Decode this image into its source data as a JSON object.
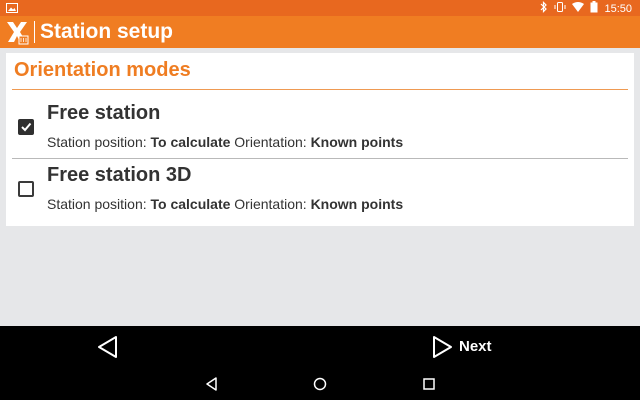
{
  "status_bar": {
    "time": "15:50",
    "icons": [
      "gallery-icon",
      "bluetooth-icon",
      "vibrate-icon",
      "wifi-icon",
      "battery-icon"
    ]
  },
  "app_bar": {
    "title": "Station setup",
    "logo": "xpad-logo-icon"
  },
  "section": {
    "title": "Orientation modes"
  },
  "options": [
    {
      "title": "Free station",
      "checked": true,
      "position_label": "Station position:",
      "position_value": "To calculate",
      "orientation_label": "Orientation:",
      "orientation_value": "Known points"
    },
    {
      "title": "Free station 3D",
      "checked": false,
      "position_label": "Station position:",
      "position_value": "To calculate",
      "orientation_label": "Orientation:",
      "orientation_value": "Known points"
    }
  ],
  "bottom_bar": {
    "back_icon": "back-triangle-icon",
    "next_label": "Next",
    "next_icon": "next-triangle-icon"
  },
  "nav_bar": {
    "icons": [
      "nav-back-icon",
      "nav-home-icon",
      "nav-recents-icon"
    ]
  },
  "colors": {
    "status_bar": "#e8681f",
    "app_bar": "#f07d22",
    "accent": "#ef7d22",
    "background": "#e6e7e9"
  }
}
